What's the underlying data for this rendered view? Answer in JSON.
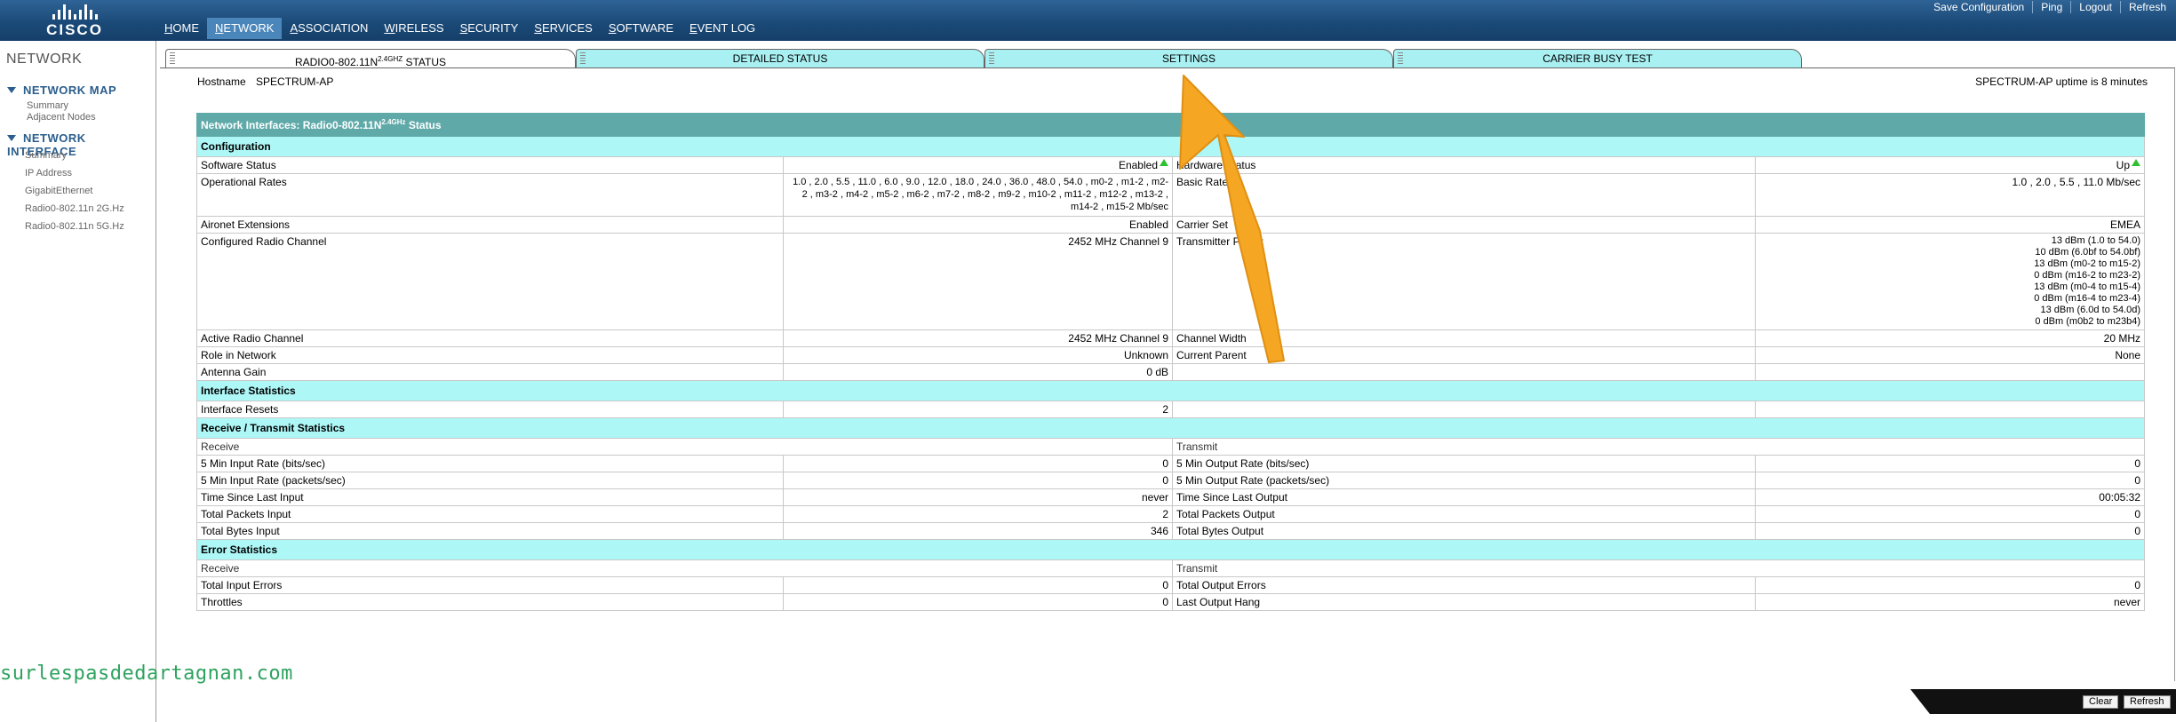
{
  "topbar": {
    "logo_text": "CISCO",
    "nav": [
      "HOME",
      "NETWORK",
      "ASSOCIATION",
      "WIRELESS",
      "SECURITY",
      "SERVICES",
      "SOFTWARE",
      "EVENT LOG"
    ],
    "active_nav": "NETWORK",
    "links": [
      "Save Configuration",
      "Ping",
      "Logout",
      "Refresh"
    ]
  },
  "sidebar": {
    "title": "NETWORK",
    "network_map": {
      "label": "NETWORK MAP",
      "items": [
        "Summary",
        "Adjacent Nodes"
      ]
    },
    "network_interface": {
      "label": "NETWORK INTERFACE",
      "items": [
        "Summary",
        "IP Address",
        "GigabitEthernet",
        "Radio0-802.11n 2G.Hz",
        "Radio0-802.11n 5G.Hz"
      ]
    }
  },
  "tabs": {
    "status": "RADIO0-802.11N",
    "status_sup": "2.4GHZ",
    "status_suffix": "STATUS",
    "detailed": "DETAILED STATUS",
    "settings": "SETTINGS",
    "carrier": "CARRIER BUSY TEST"
  },
  "header": {
    "hostname_label": "Hostname",
    "hostname_value": "SPECTRUM-AP",
    "uptime": "SPECTRUM-AP uptime is 8 minutes"
  },
  "table": {
    "banner": "Network Interfaces: Radio0-802.11N",
    "banner_sup": "2.4GHz",
    "banner_suffix": "Status",
    "config_title": "Configuration",
    "rows": {
      "software_status": {
        "label": "Software Status",
        "value": "Enabled",
        "label2": "Hardware Status",
        "value2": "Up"
      },
      "operational_rates": {
        "label": "Operational Rates",
        "value": "1.0 , 2.0 , 5.5 , 11.0 , 6.0 , 9.0 , 12.0 , 18.0 , 24.0 , 36.0 , 48.0 , 54.0 , m0-2 , m1-2 , m2-2 , m3-2 , m4-2 , m5-2 , m6-2 , m7-2 , m8-2 , m9-2 , m10-2 , m11-2 , m12-2 , m13-2 , m14-2 , m15-2 Mb/sec",
        "label2": "Basic Rates",
        "value2": "1.0 , 2.0 , 5.5 , 11.0 Mb/sec"
      },
      "aironet": {
        "label": "Aironet Extensions",
        "value": "Enabled",
        "label2": "Carrier Set",
        "value2": "EMEA"
      },
      "configured_channel": {
        "label": "Configured Radio Channel",
        "value": "2452 MHz Channel 9",
        "label2": "Transmitter Power",
        "value2_lines": [
          "13 dBm (1.0 to 54.0)",
          "10 dBm (6.0bf to 54.0bf)",
          "13 dBm (m0-2 to m15-2)",
          "0 dBm (m16-2 to m23-2)",
          "13 dBm (m0-4 to m15-4)",
          "0 dBm (m16-4 to m23-4)",
          "13 dBm (6.0d to 54.0d)",
          "0 dBm (m0b2 to m23b4)"
        ]
      },
      "active_channel": {
        "label": "Active Radio Channel",
        "value": "2452 MHz Channel 9",
        "label2": "Channel Width",
        "value2": "20 MHz"
      },
      "role": {
        "label": "Role in Network",
        "value": "Unknown",
        "label2": "Current Parent",
        "value2": "None"
      },
      "antenna": {
        "label": "Antenna Gain",
        "value": "0 dB"
      }
    },
    "iface_stats_title": "Interface Statistics",
    "iface_resets": {
      "label": "Interface Resets",
      "value": "2"
    },
    "rxtx_title": "Receive / Transmit Statistics",
    "receive": "Receive",
    "transmit": "Transmit",
    "rxtx_rows": [
      {
        "l1": "5 Min Input Rate (bits/sec)",
        "v1": "0",
        "l2": "5 Min Output Rate (bits/sec)",
        "v2": "0"
      },
      {
        "l1": "5 Min Input Rate (packets/sec)",
        "v1": "0",
        "l2": "5 Min Output Rate (packets/sec)",
        "v2": "0"
      },
      {
        "l1": "Time Since Last Input",
        "v1": "never",
        "l2": "Time Since Last Output",
        "v2": "00:05:32"
      },
      {
        "l1": "Total Packets Input",
        "v1": "2",
        "l2": "Total Packets Output",
        "v2": "0"
      },
      {
        "l1": "Total Bytes Input",
        "v1": "346",
        "l2": "Total Bytes Output",
        "v2": "0"
      }
    ],
    "error_title": "Error Statistics",
    "error_rows": [
      {
        "l1": "Total Input Errors",
        "v1": "0",
        "l2": "Total Output Errors",
        "v2": "0"
      },
      {
        "l1": "Throttles",
        "v1": "0",
        "l2": "Last Output Hang",
        "v2": "never"
      }
    ]
  },
  "bottom": {
    "clear": "Clear",
    "refresh": "Refresh"
  },
  "watermark": "surlespasdedartagnan.com",
  "colors": {
    "topbar": "#1b4a78",
    "banner": "#5fa9a9",
    "section": "#aef7f7",
    "arrow": "#f5a623"
  }
}
